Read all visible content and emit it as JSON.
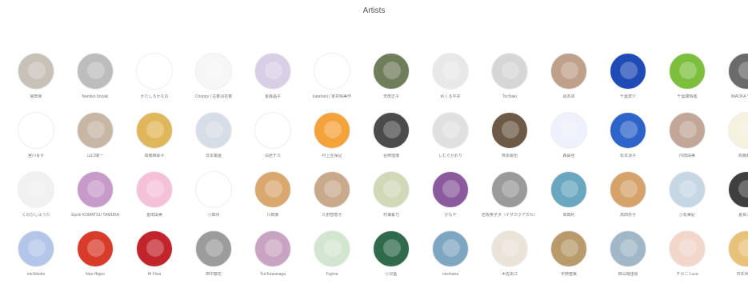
{
  "header": {
    "title": "Artists"
  },
  "artists": [
    {
      "name": "宮田幸",
      "color": "#c7c1b7"
    },
    {
      "name": "Namiko Itozaki",
      "color": "#bdbdbd"
    },
    {
      "name": "かたしろかなの",
      "color": "#ffffff"
    },
    {
      "name": "Choppy | 古着羽衣着",
      "color": "#f6f6f6"
    },
    {
      "name": "金森晶子",
      "color": "#d8cfe6"
    },
    {
      "name": "katahani | 家井晴美作",
      "color": "#ffffff"
    },
    {
      "name": "天田正子",
      "color": "#6f7d5b"
    },
    {
      "name": "めくる平井",
      "color": "#e8e8e8"
    },
    {
      "name": "Tochiaki",
      "color": "#d6d6d6"
    },
    {
      "name": "岡本卓",
      "color": "#bfa08a"
    },
    {
      "name": "千葉恵介",
      "color": "#1f4bb6"
    },
    {
      "name": "千葉康晴進",
      "color": "#7bbf3d"
    },
    {
      "name": "IMAOKA YUKIKO",
      "color": "#6b6b6b"
    },
    {
      "name": "宮川青子",
      "color": "#ffffff"
    },
    {
      "name": "山口瑞一",
      "color": "#c6b6a3"
    },
    {
      "name": "高橋麻耶子",
      "color": "#e0b65a"
    },
    {
      "name": "日本童画",
      "color": "#d6dde6"
    },
    {
      "name": "白居チカ",
      "color": "#ffffff"
    },
    {
      "name": "村上生保記",
      "color": "#f4a23a"
    },
    {
      "name": "谷崎理博",
      "color": "#4b4b4b"
    },
    {
      "name": "しむらかおり",
      "color": "#e0e0e0"
    },
    {
      "name": "熊本陽也",
      "color": "#6c5a46"
    },
    {
      "name": "森由佳",
      "color": "#eef1fb"
    },
    {
      "name": "松本涼子",
      "color": "#2e63c9"
    },
    {
      "name": "内田由美",
      "color": "#c2a697"
    },
    {
      "name": "高橋和彦",
      "color": "#f4f1de"
    },
    {
      "name": "くのひしゅうた",
      "color": "#f1f1f1"
    },
    {
      "name": "Sachi KOMATSU TAMURA",
      "color": "#c69ac9"
    },
    {
      "name": "金田由美",
      "color": "#f4c1d8"
    },
    {
      "name": "小田州",
      "color": "#ffffff"
    },
    {
      "name": "川田楽",
      "color": "#d9a86e"
    },
    {
      "name": "久野智恵子",
      "color": "#c9a98c"
    },
    {
      "name": "村瀬紫乃",
      "color": "#d1d8b8"
    },
    {
      "name": "かもや",
      "color": "#8a5a9d"
    },
    {
      "name": "岩坂英子ダ（イザカクアカセ）",
      "color": "#9a9a9a"
    },
    {
      "name": "高田利",
      "color": "#69a6bf"
    },
    {
      "name": "高田崇子",
      "color": "#d5a26a"
    },
    {
      "name": "小松美紀",
      "color": "#c6d6e3"
    },
    {
      "name": "夏目大宗",
      "color": "#3f3f3f"
    },
    {
      "name": "michikoko",
      "color": "#b3c5e8"
    },
    {
      "name": "Nao Hippo",
      "color": "#d93b2a"
    },
    {
      "name": "Hi Fivia",
      "color": "#c2242c"
    },
    {
      "name": "田中藤花",
      "color": "#9c9c9c"
    },
    {
      "name": "Yui Kawanaga",
      "color": "#c9a4c2"
    },
    {
      "name": "Fujima",
      "color": "#d2e6cf"
    },
    {
      "name": "小早藍",
      "color": "#2f6a4c"
    },
    {
      "name": "nicohana",
      "color": "#7fa6c1"
    },
    {
      "name": "木佐由江",
      "color": "#e9e3d8"
    },
    {
      "name": "宇野亜美",
      "color": "#b99a6a"
    },
    {
      "name": "田山瑞佳絵",
      "color": "#9fb7c6"
    },
    {
      "name": "チボニ Luca",
      "color": "#f1d6c9"
    },
    {
      "name": "日本米卓翔",
      "color": "#e8c27a"
    }
  ]
}
